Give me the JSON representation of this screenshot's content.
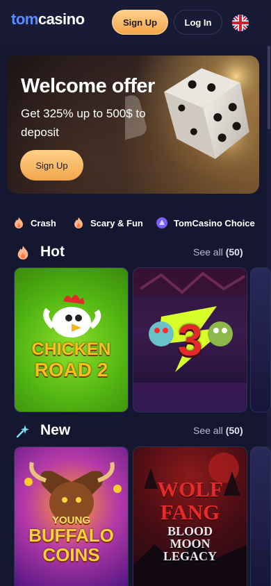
{
  "header": {
    "logo_part1": "tom",
    "logo_part2": "casino",
    "signup_label": "Sign Up",
    "login_label": "Log In",
    "language_icon": "uk-flag-icon"
  },
  "banner": {
    "title": "Welcome offer",
    "subtitle": "Get 325% up to 500$ to deposit",
    "cta_label": "Sign Up"
  },
  "categories": [
    {
      "label": "Crash",
      "icon": "flame-icon"
    },
    {
      "label": "Scary & Fun",
      "icon": "flame-icon"
    },
    {
      "label": "TomCasino Choice",
      "icon": "tomcasino-logo-icon"
    }
  ],
  "sections": [
    {
      "title": "Hot",
      "icon": "flame-icon",
      "see_all_label": "See all",
      "count": "(50)",
      "games": [
        {
          "title_line1": "CHICKEN",
          "title_line2": "ROAD 2"
        },
        {
          "title_line1": "3"
        }
      ]
    },
    {
      "title": "New",
      "icon": "sparkle-icon",
      "see_all_label": "See all",
      "count": "(50)",
      "games": [
        {
          "title_line1": "YOUNG",
          "title_line2": "BUFFALO",
          "title_line3": "COINS"
        },
        {
          "title_line1": "WOLF",
          "title_line2": "FANG",
          "title_line3": "BLOOD",
          "title_line4": "MOON",
          "title_line5": "LEGACY"
        }
      ]
    }
  ],
  "colors": {
    "background": "#151630",
    "accent_gold": "#f3a64a",
    "logo_blue": "#5b8cff"
  }
}
